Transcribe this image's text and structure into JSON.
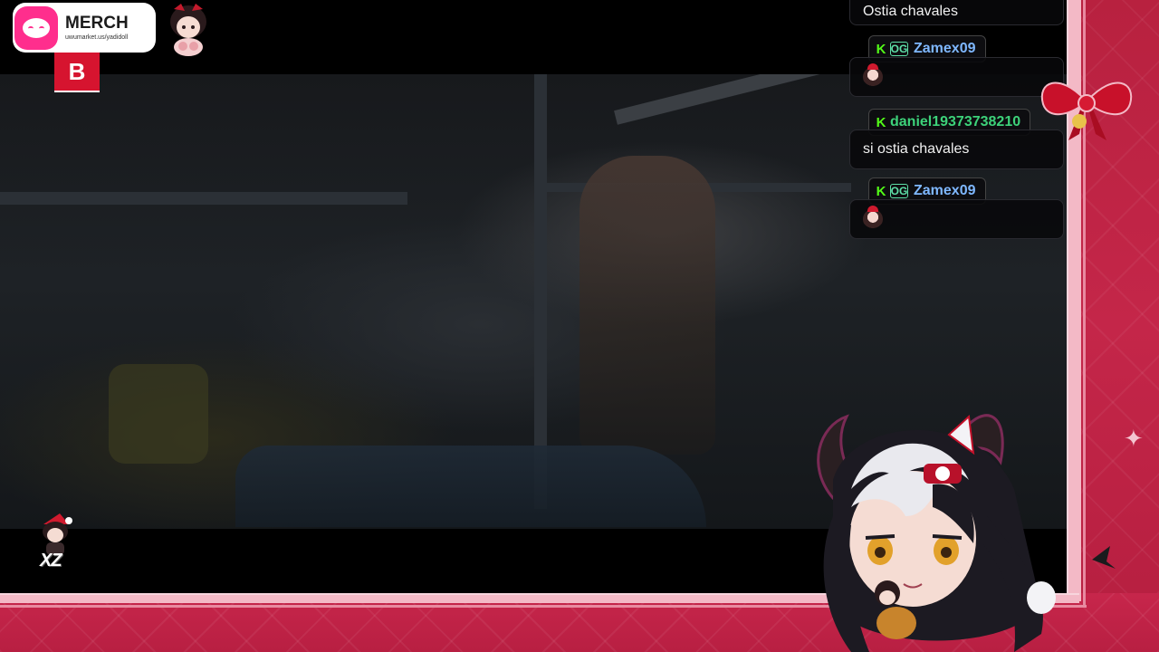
{
  "merch": {
    "title": "MERCH",
    "url": "uwumarket.us/yadidoll"
  },
  "badge_letter": "B",
  "corner_text": "XZ",
  "chat": {
    "messages": [
      {
        "type": "text",
        "text": "Ostia chavales"
      },
      {
        "type": "user",
        "username": "Zamex09",
        "badges": [
          "K",
          "OG"
        ],
        "color": "#7fb8ff"
      },
      {
        "type": "emote",
        "emote": "chibi-emote"
      },
      {
        "type": "user",
        "username": "daniel19373738210",
        "badges": [
          "K"
        ],
        "color": "#3dd27a"
      },
      {
        "type": "text",
        "text": "si ostia chavales"
      },
      {
        "type": "user",
        "username": "Zamex09",
        "badges": [
          "K",
          "OG"
        ],
        "color": "#7fb8ff"
      },
      {
        "type": "emote",
        "emote": "chibi-santa-emote"
      }
    ]
  },
  "colors": {
    "frame_pink": "#f3b9c6",
    "panel_red": "#c42649",
    "merch_pink": "#ff2e8d",
    "badge_red": "#d6142f",
    "kick_green": "#53fc18"
  }
}
